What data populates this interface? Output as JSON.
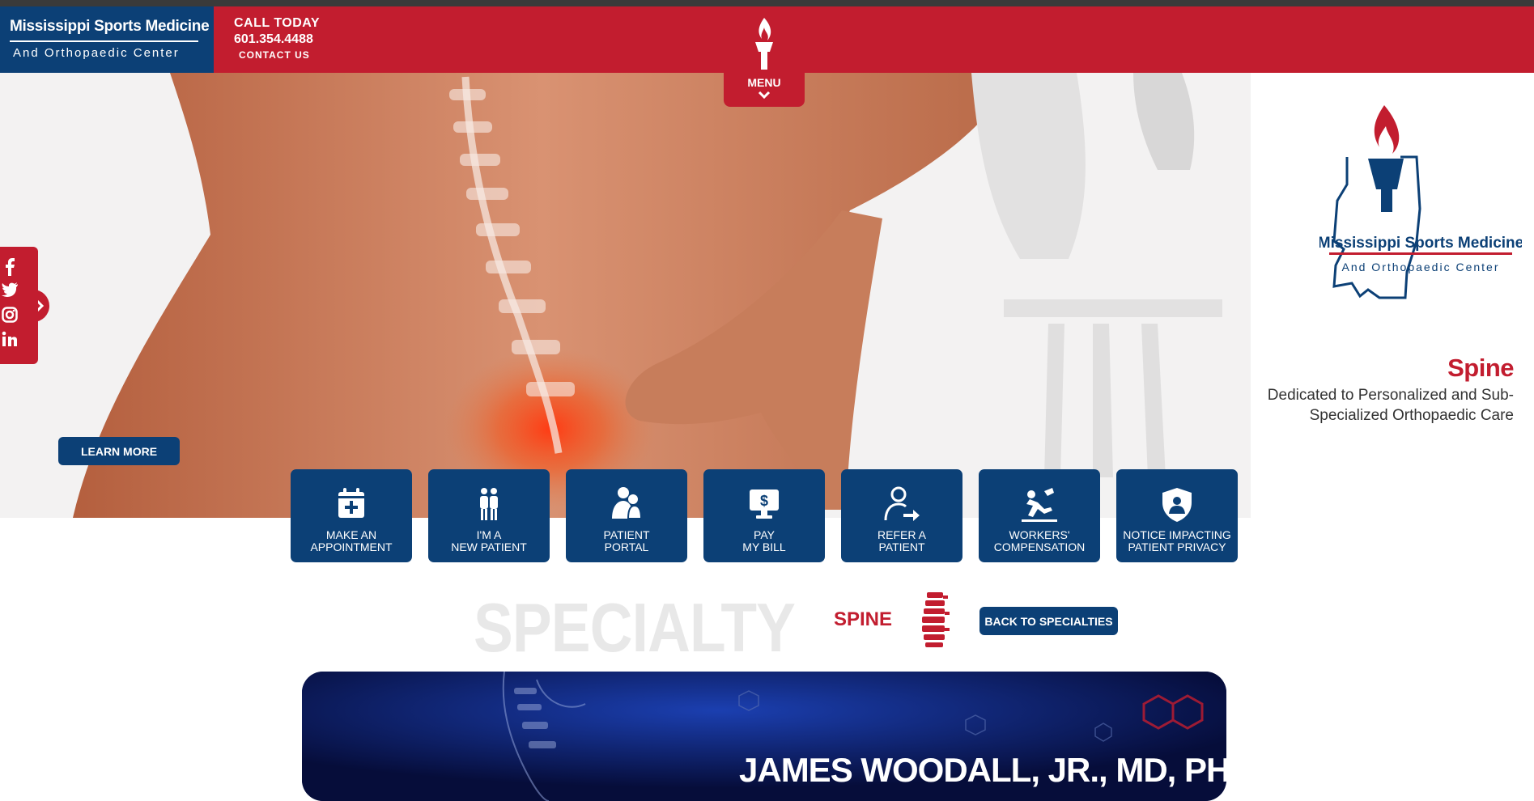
{
  "colors": {
    "brand_red": "#c21d2f",
    "brand_blue": "#0c4076",
    "text_gray": "#333333",
    "watermark_gray": "#e8e8e8"
  },
  "header": {
    "brand_name": "Mississippi Sports Medicine",
    "brand_sub": "And Orthopaedic Center",
    "call_label": "CALL TODAY",
    "phone": "601.354.4488",
    "contact": "CONTACT US",
    "menu_label": "MENU"
  },
  "hero": {
    "logo_name": "Mississippi Sports Medicine",
    "logo_sub": "And Orthopaedic Center",
    "title": "Spine",
    "description": "Dedicated to Personalized and Sub-Specialized Orthopaedic Care",
    "learn_more": "LEARN MORE"
  },
  "social": [
    {
      "icon": "facebook-icon",
      "glyph": "f"
    },
    {
      "icon": "twitter-icon",
      "glyph": "t"
    },
    {
      "icon": "instagram-icon",
      "glyph": "ig"
    },
    {
      "icon": "linkedin-icon",
      "glyph": "in"
    }
  ],
  "quick_links": [
    {
      "label": "MAKE AN\nAPPOINTMENT",
      "icon": "calendar-plus-icon"
    },
    {
      "label": "I'M A\nNEW PATIENT",
      "icon": "patient-icon"
    },
    {
      "label": "PATIENT\nPORTAL",
      "icon": "family-icon"
    },
    {
      "label": "PAY\nMY BILL",
      "icon": "computer-dollar-icon"
    },
    {
      "label": "REFER A\nPATIENT",
      "icon": "refer-user-icon"
    },
    {
      "label": "WORKERS'\nCOMPENSATION",
      "icon": "fall-injury-icon"
    },
    {
      "label": "NOTICE IMPACTING\nPATIENT PRIVACY",
      "icon": "shield-user-icon"
    }
  ],
  "specialty": {
    "heading": "SPECIALTY",
    "name": "SPINE",
    "back_button": "BACK TO SPECIALTIES"
  },
  "promo": {
    "doctor_name": "JAMES WOODALL, JR., MD, PHD"
  }
}
